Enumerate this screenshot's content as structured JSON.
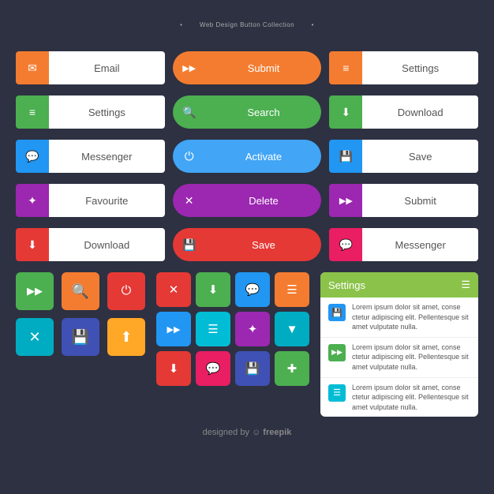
{
  "title": {
    "dot1": "•",
    "main": "Web Design Button Collection",
    "dot2": "•"
  },
  "row1": [
    {
      "icon": "✉",
      "label": "Email",
      "iconBg": "bg-orange"
    },
    {
      "type": "pill",
      "icon": "▶▶",
      "label": "Submit",
      "bg": "bg-orange"
    },
    {
      "icon": "☰",
      "label": "Settings",
      "iconBg": "bg-orange"
    }
  ],
  "row2": [
    {
      "icon": "☰",
      "label": "Settings",
      "iconBg": "bg-green"
    },
    {
      "type": "pill",
      "icon": "🔍",
      "label": "Search",
      "bg": "bg-green"
    },
    {
      "icon": "⬇",
      "label": "Download",
      "iconBg": "bg-green"
    }
  ],
  "row3": [
    {
      "icon": "💬",
      "label": "Messenger",
      "iconBg": "bg-blue"
    },
    {
      "type": "pill",
      "icon": "⏻",
      "label": "Activate",
      "bg": "bg-blue"
    },
    {
      "icon": "💾",
      "label": "Save",
      "iconBg": "bg-blue"
    }
  ],
  "row4": [
    {
      "icon": "✶",
      "label": "Favourite",
      "iconBg": "bg-purple"
    },
    {
      "type": "pill",
      "icon": "✕",
      "label": "Delete",
      "bg": "bg-purple"
    },
    {
      "icon": "▶▶",
      "label": "Submit",
      "iconBg": "bg-purple"
    }
  ],
  "row5": [
    {
      "icon": "⬇",
      "label": "Download",
      "iconBg": "bg-red"
    },
    {
      "type": "pill",
      "icon": "💾",
      "label": "Save",
      "bg": "bg-red"
    },
    {
      "icon": "💬",
      "label": "Messenger",
      "iconBg": "bg-pink"
    }
  ],
  "small_btns_row1": [
    {
      "icon": "▶▶",
      "bg": "bg-green"
    },
    {
      "icon": "🔍",
      "bg": "bg-orange"
    },
    {
      "icon": "⏻",
      "bg": "bg-red"
    }
  ],
  "small_btns_row2": [
    {
      "icon": "✕",
      "bg": "bg-cyan"
    },
    {
      "icon": "💾",
      "bg": "bg-indigo"
    },
    {
      "icon": "⬆",
      "bg": "bg-amber"
    }
  ],
  "middle_row1_icons": [
    {
      "icon": "✕",
      "bg": "bg-red"
    },
    {
      "icon": "⬇",
      "bg": "bg-green"
    },
    {
      "icon": "💬",
      "bg": "bg-blue"
    },
    {
      "icon": "☰",
      "bg": "bg-orange"
    }
  ],
  "middle_row2_icons": [
    {
      "icon": "▶▶",
      "bg": "bg-blue"
    },
    {
      "icon": "☰",
      "bg": "bg-teal"
    },
    {
      "icon": "✶",
      "bg": "bg-purple"
    },
    {
      "icon": "▼",
      "bg": "bg-cyan"
    }
  ],
  "middle_row3_icons": [
    {
      "icon": "⬇",
      "bg": "bg-red"
    },
    {
      "icon": "💬",
      "bg": "bg-pink"
    },
    {
      "icon": "💾",
      "bg": "bg-indigo"
    },
    {
      "icon": "✚",
      "bg": "bg-green"
    }
  ],
  "settings_card": {
    "header": "Settings",
    "items": [
      {
        "icon": "💾",
        "iconBg": "bg-blue",
        "text": "Lorem ipsum dolor sit amet, conse ctetur adipiscing elit. Pellentesque sit amet vulputate nulla."
      },
      {
        "icon": "▶▶",
        "iconBg": "bg-green",
        "text": "Lorem ipsum dolor sit amet, conse ctetur adipiscing elit. Pellentesque sit amet vulputate nulla."
      },
      {
        "icon": "☰",
        "iconBg": "bg-teal",
        "text": "Lorem ipsum dolor sit amet, conse ctetur adipiscing elit. Pellentesque sit amet vulputate nulla."
      }
    ]
  },
  "footer": {
    "text": "designed by",
    "brand": "freepik"
  }
}
